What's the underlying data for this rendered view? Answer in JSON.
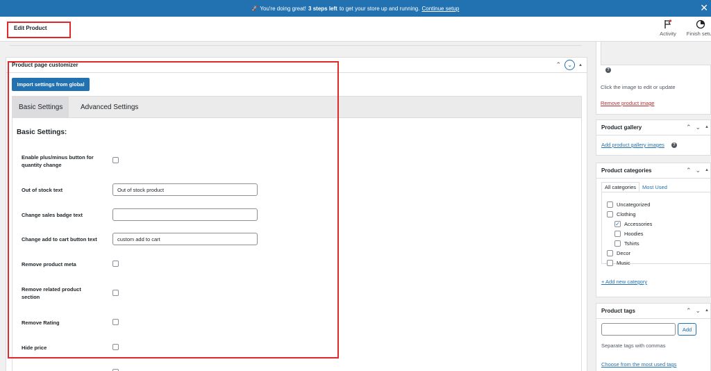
{
  "notice": {
    "rocket_glyph": "🚀",
    "text_before": "You're doing great!",
    "steps_text": "3 steps left",
    "text_after": "to get your store up and running.",
    "link": "Continue setup",
    "close_glyph": "✕"
  },
  "header": {
    "title": "Edit Product",
    "activity_label": "Activity",
    "finish_setup_label": "Finish setup"
  },
  "metabox": {
    "title": "Product page customizer",
    "import_button": "Import settings from global",
    "tabs": [
      {
        "label": "Basic Settings",
        "active": true
      },
      {
        "label": "Advanced Settings",
        "active": false
      }
    ],
    "section_title": "Basic Settings:",
    "rows": {
      "plus_minus": {
        "label": "Enable plus/minus button for quantity change",
        "checked": false
      },
      "out_of_stock": {
        "label": "Out of stock text",
        "value": "Out of stock product"
      },
      "sales_badge": {
        "label": "Change sales badge text",
        "value": ""
      },
      "add_to_cart": {
        "label": "Change add to cart button text",
        "value": "custom add to cart"
      },
      "remove_meta": {
        "label": "Remove product meta",
        "checked": false
      },
      "remove_related": {
        "label": "Remove related product section",
        "checked": false
      },
      "remove_rating": {
        "label": "Remove Rating",
        "checked": false
      },
      "hide_price": {
        "label": "Hide price",
        "checked": false
      }
    }
  },
  "sidebar": {
    "product_image": {
      "help_glyph": "?",
      "hint": "Click the image to edit or update",
      "remove_link": "Remove product image"
    },
    "gallery": {
      "title": "Product gallery",
      "link": "Add product gallery images",
      "help_glyph": "?"
    },
    "categories": {
      "title": "Product categories",
      "tab_all": "All categories",
      "tab_most_used": "Most Used",
      "items": [
        {
          "label": "Uncategorized",
          "checked": false,
          "level": 0
        },
        {
          "label": "Clothing",
          "checked": false,
          "level": 0
        },
        {
          "label": "Accessories",
          "checked": true,
          "level": 1
        },
        {
          "label": "Hoodies",
          "checked": false,
          "level": 1
        },
        {
          "label": "Tshirts",
          "checked": false,
          "level": 1
        },
        {
          "label": "Decor",
          "checked": false,
          "level": 0
        },
        {
          "label": "Music",
          "checked": false,
          "level": 0
        }
      ],
      "add_link": "+ Add new category"
    },
    "tags": {
      "title": "Product tags",
      "add_button": "Add",
      "hint": "Separate tags with commas",
      "choose_link": "Choose from the most used tags"
    }
  },
  "colors": {
    "accent": "#2271b1",
    "highlight_border": "#e32626"
  }
}
